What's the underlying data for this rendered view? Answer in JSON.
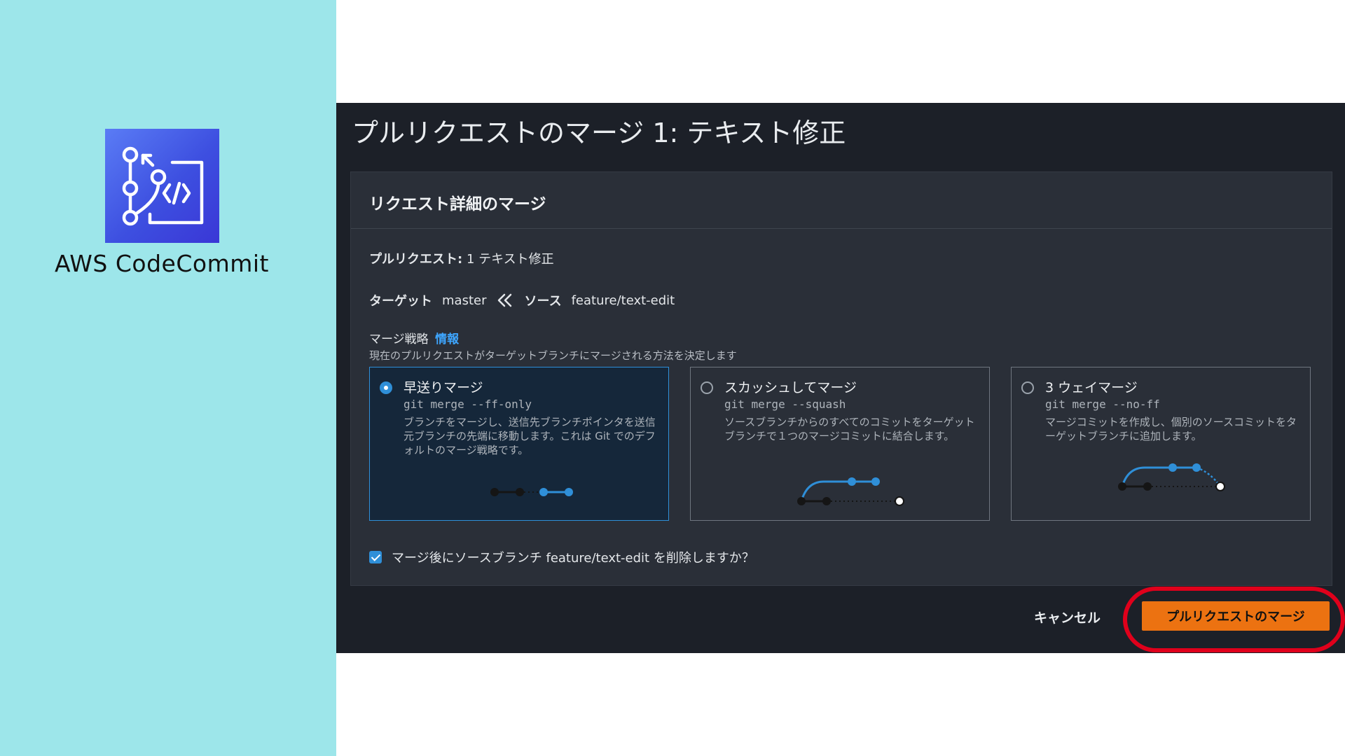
{
  "colors": {
    "left_panel_bg": "#9de6ea",
    "console_bg": "#1c2028",
    "card_bg": "#2a2f38",
    "accent_blue": "#2f8fd8",
    "primary_button": "#ec7211",
    "highlight_ring": "#e0001b"
  },
  "logo": {
    "icon": "codecommit-icon",
    "caption": "AWS CodeCommit"
  },
  "page": {
    "title": "プルリクエストのマージ 1: テキスト修正"
  },
  "card": {
    "title": "リクエスト詳細のマージ",
    "pull_request_label": "プルリクエスト:",
    "pull_request_value": "1 テキスト修正",
    "target_label": "ターゲット",
    "target_value": "master",
    "source_label": "ソース",
    "source_value": "feature/text-edit",
    "strategy_label": "マージ戦略",
    "info_link": "情報",
    "strategy_description": "現在のプルリクエストがターゲットブランチにマージされる方法を決定します"
  },
  "strategies": [
    {
      "title": "早送りマージ",
      "command": "git merge --ff-only",
      "description": "ブランチをマージし、送信先ブランチポインタを送信元ブランチの先端に移動します。これは Git でのデフォルトのマージ戦略です。",
      "selected": true
    },
    {
      "title": "スカッシュしてマージ",
      "command": "git merge --squash",
      "description": "ソースブランチからのすべてのコミットをターゲットブランチで１つのマージコミットに結合します。",
      "selected": false
    },
    {
      "title": "3 ウェイマージ",
      "command": "git merge --no-ff",
      "description": "マージコミットを作成し、個別のソースコミットをターゲットブランチに追加します。",
      "selected": false
    }
  ],
  "delete_branch": {
    "checked": true,
    "prefix": "マージ後にソースブランチ",
    "branch": "feature/text-edit",
    "suffix": "を削除しますか？"
  },
  "actions": {
    "cancel": "キャンセル",
    "merge": "プルリクエストのマージ"
  }
}
